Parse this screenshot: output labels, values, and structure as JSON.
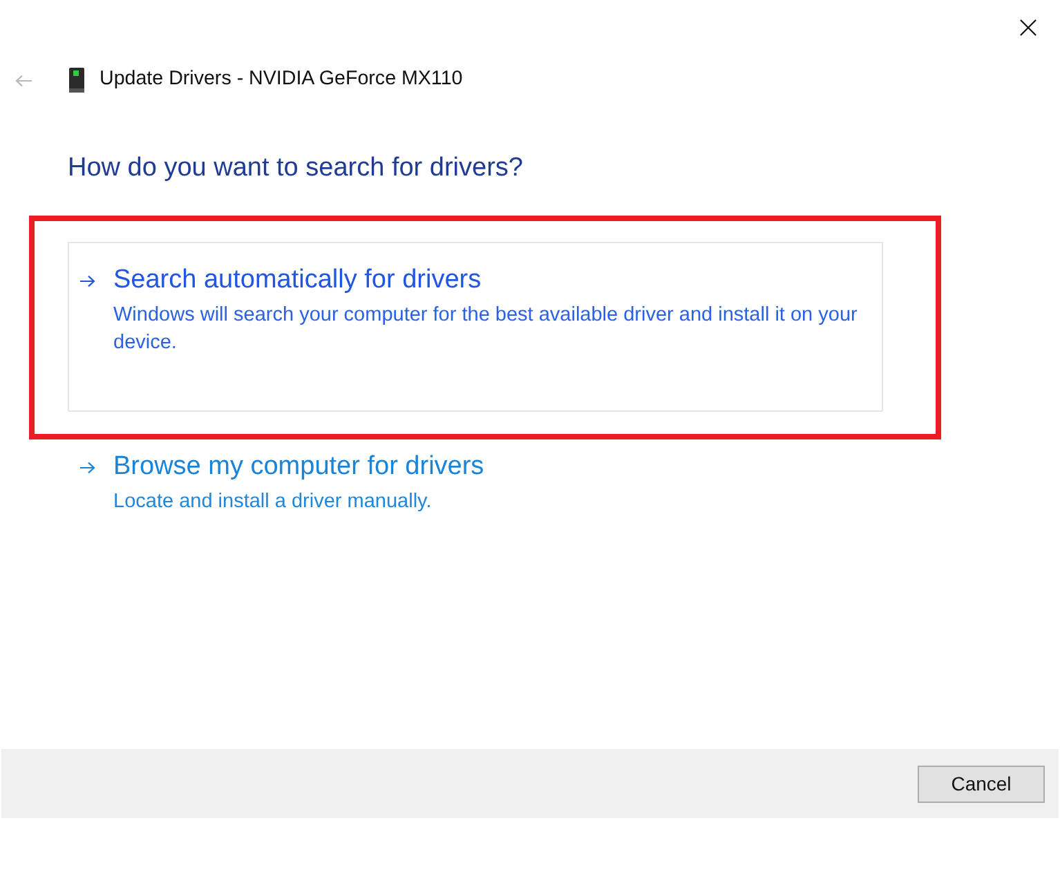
{
  "window": {
    "title": "Update Drivers - NVIDIA GeForce MX110",
    "back_button": {
      "disabled": true
    }
  },
  "heading": "How do you want to search for drivers?",
  "options": [
    {
      "title": "Search automatically for drivers",
      "description": "Windows will search your computer for the best available driver and install it on your device.",
      "hovered": true,
      "highlighted": true
    },
    {
      "title": "Browse my computer for drivers",
      "description": "Locate and install a driver manually.",
      "hovered": false,
      "highlighted": false
    }
  ],
  "buttons": [
    {
      "label": "Cancel"
    }
  ]
}
